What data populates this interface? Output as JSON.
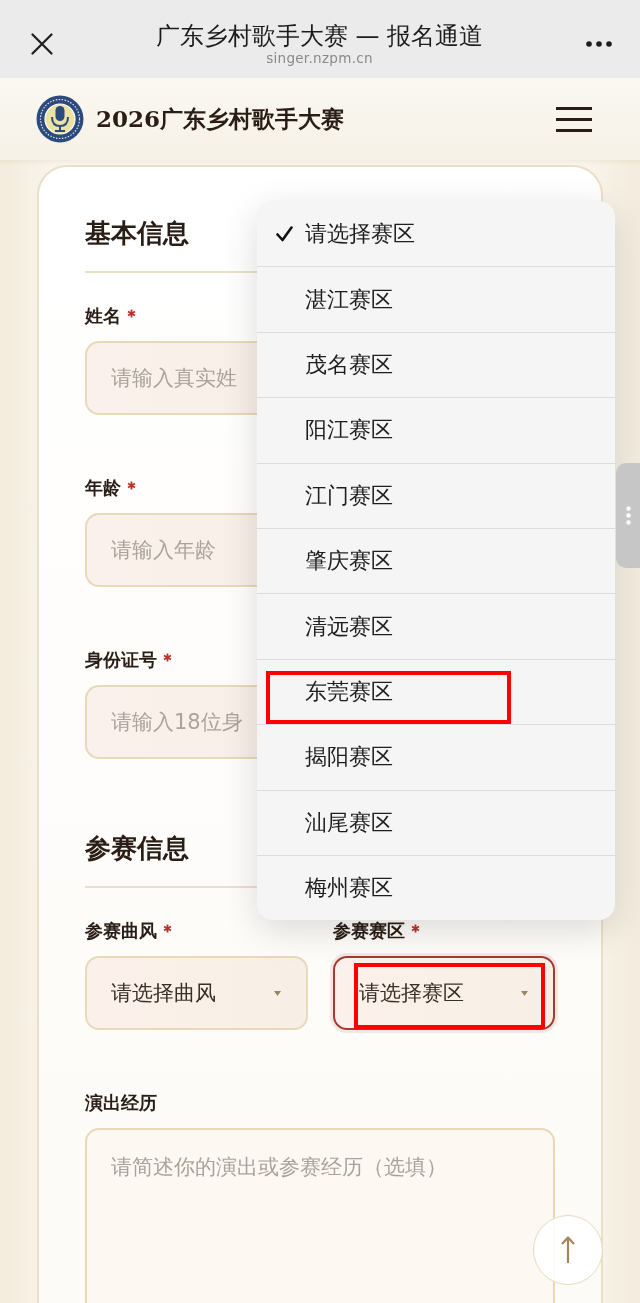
{
  "browser_bar": {
    "title": "广东乡村歌手大赛 — 报名通道",
    "url": "singer.nzpm.cn"
  },
  "site_header": {
    "title": "2026广东乡村歌手大赛"
  },
  "form": {
    "sections": [
      {
        "heading": "基本信息",
        "fields": [
          {
            "kind": "input",
            "label": "姓名",
            "required": true,
            "placeholder": "请输入真实姓",
            "focused": false,
            "marked": false
          },
          {
            "kind": "input",
            "label": "年龄",
            "required": true,
            "placeholder": "请输入年龄",
            "focused": false,
            "marked": false
          },
          {
            "kind": "input",
            "label": "身份证号",
            "required": true,
            "placeholder": "请输入18位身",
            "focused": false,
            "marked": false
          }
        ]
      },
      {
        "heading": "参赛信息",
        "fields": [
          {
            "kind": "select",
            "label": "参赛曲风",
            "required": true,
            "value": "请选择曲风",
            "focused": false,
            "marked": false
          },
          {
            "kind": "select",
            "label": "参赛赛区",
            "required": true,
            "value": "请选择赛区",
            "focused": true,
            "marked": true
          },
          {
            "kind": "textarea",
            "label": "演出经历",
            "required": false,
            "placeholder": "请简述你的演出或参赛经历（选填）",
            "focused": false,
            "marked": false
          }
        ]
      }
    ]
  },
  "dropdown": {
    "options": [
      {
        "label": "请选择赛区",
        "selected": true,
        "marked": false
      },
      {
        "label": "湛江赛区",
        "selected": false,
        "marked": false
      },
      {
        "label": "茂名赛区",
        "selected": false,
        "marked": false
      },
      {
        "label": "阳江赛区",
        "selected": false,
        "marked": false
      },
      {
        "label": "江门赛区",
        "selected": false,
        "marked": false
      },
      {
        "label": "肇庆赛区",
        "selected": false,
        "marked": false
      },
      {
        "label": "清远赛区",
        "selected": false,
        "marked": false
      },
      {
        "label": "东莞赛区",
        "selected": false,
        "marked": true
      },
      {
        "label": "揭阳赛区",
        "selected": false,
        "marked": false
      },
      {
        "label": "汕尾赛区",
        "selected": false,
        "marked": false
      },
      {
        "label": "梅州赛区",
        "selected": false,
        "marked": false
      }
    ]
  }
}
